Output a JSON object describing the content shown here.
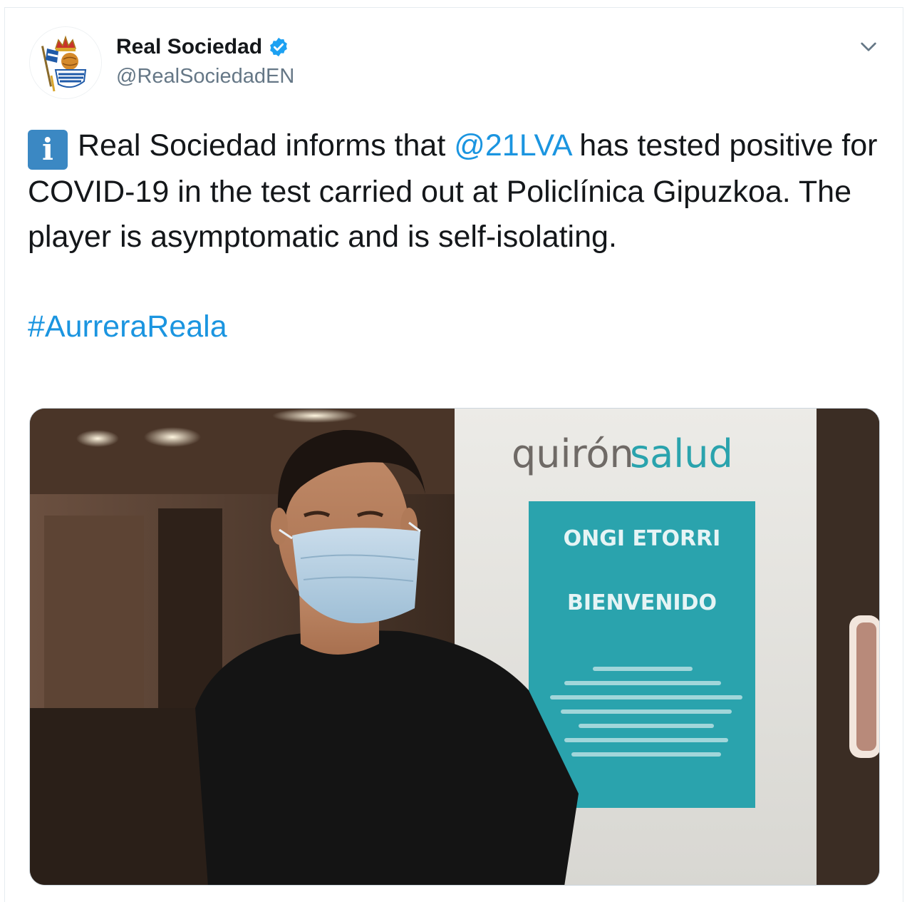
{
  "account": {
    "display_name": "Real Sociedad",
    "handle": "@RealSociedadEN",
    "verified": true
  },
  "tweet": {
    "info_emoji": "i",
    "text_before_mention": "Real Sociedad informs that ",
    "mention": "@21LVA",
    "text_after_mention": " has tested positive for COVID-19 in the test carried out at Policlínica Gipuzkoa. The player is asymptomatic and is self-isolating.",
    "hashtag": "#AurreraReala"
  },
  "media": {
    "sign_brand_part1": "quirón",
    "sign_brand_part2": "salud",
    "sign_line1": "ONGI ETORRI",
    "sign_line2": "BIENVENIDO"
  },
  "colors": {
    "link": "#1b95e0",
    "verified_badge": "#1da1f2",
    "sign_teal": "#2aa3ad"
  },
  "icons": {
    "chevron": "chevron-down-icon",
    "verified": "verified-badge-icon",
    "info": "information-emoji-icon"
  }
}
